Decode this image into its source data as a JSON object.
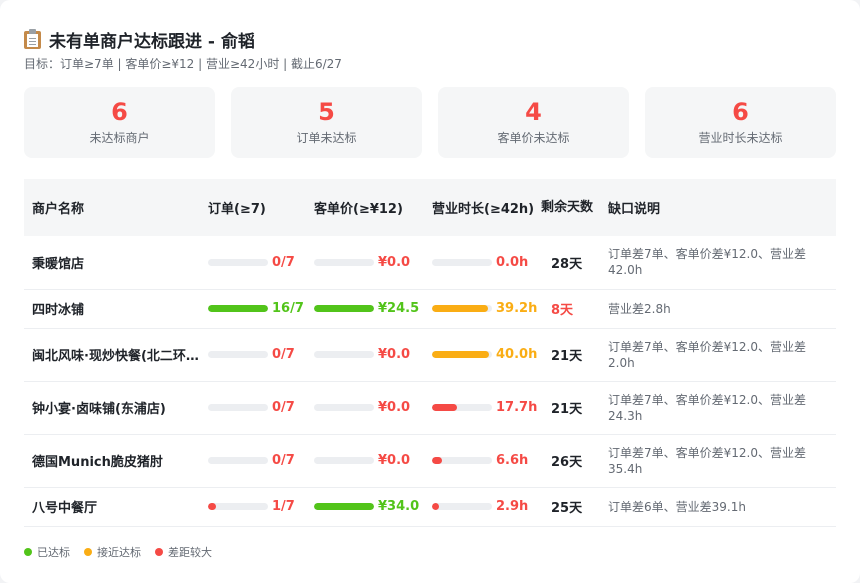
{
  "colors": {
    "green": "#52c41a",
    "yellow": "#faad14",
    "red": "#f54a45",
    "track": "#eceef1"
  },
  "header": {
    "icon": "clipboard-icon",
    "title": "未有单商户达标跟进 - 俞韬",
    "subtitle": "目标：订单≥7单 | 客单价≥¥12 | 营业≥42小时 | 截止6/27"
  },
  "stats": [
    {
      "value": "6",
      "label": "未达标商户"
    },
    {
      "value": "5",
      "label": "订单未达标"
    },
    {
      "value": "4",
      "label": "客单价未达标"
    },
    {
      "value": "6",
      "label": "营业时长未达标"
    }
  ],
  "table": {
    "columns": [
      "商户名称",
      "订单(≥7)",
      "客单价(≥¥12)",
      "营业时长(≥42h)",
      "剩余天数",
      "缺口说明"
    ],
    "rows": [
      {
        "name": "秉暖馆店",
        "orders": {
          "text": "0/7",
          "pct": 0,
          "status": "red"
        },
        "price": {
          "text": "¥0.0",
          "pct": 0,
          "status": "red"
        },
        "hours": {
          "text": "0.0h",
          "pct": 0,
          "status": "red"
        },
        "days": "28天",
        "days_warn": false,
        "note": "订单差7单、客单价差¥12.0、营业差42.0h",
        "tall": true
      },
      {
        "name": "四时冰铺",
        "orders": {
          "text": "16/7",
          "pct": 100,
          "status": "green"
        },
        "price": {
          "text": "¥24.5",
          "pct": 100,
          "status": "green"
        },
        "hours": {
          "text": "39.2h",
          "pct": 93,
          "status": "yellow"
        },
        "days": "8天",
        "days_warn": true,
        "note": "营业差2.8h",
        "tall": false
      },
      {
        "name": "闽北风味·现炒快餐(北二环店)",
        "orders": {
          "text": "0/7",
          "pct": 0,
          "status": "red"
        },
        "price": {
          "text": "¥0.0",
          "pct": 0,
          "status": "red"
        },
        "hours": {
          "text": "40.0h",
          "pct": 95,
          "status": "yellow"
        },
        "days": "21天",
        "days_warn": false,
        "note": "订单差7单、客单价差¥12.0、营业差2.0h",
        "tall": true
      },
      {
        "name": "钟小宴·卤味铺(东浦店)",
        "orders": {
          "text": "0/7",
          "pct": 0,
          "status": "red"
        },
        "price": {
          "text": "¥0.0",
          "pct": 0,
          "status": "red"
        },
        "hours": {
          "text": "17.7h",
          "pct": 42,
          "status": "red"
        },
        "days": "21天",
        "days_warn": false,
        "note": "订单差7单、客单价差¥12.0、营业差24.3h",
        "tall": true
      },
      {
        "name": "德国Munich脆皮猪肘",
        "orders": {
          "text": "0/7",
          "pct": 0,
          "status": "red"
        },
        "price": {
          "text": "¥0.0",
          "pct": 0,
          "status": "red"
        },
        "hours": {
          "text": "6.6h",
          "pct": 16,
          "status": "red"
        },
        "days": "26天",
        "days_warn": false,
        "note": "订单差7单、客单价差¥12.0、营业差35.4h",
        "tall": true
      },
      {
        "name": "八号中餐厅",
        "orders": {
          "text": "1/7",
          "pct": 14,
          "status": "red"
        },
        "price": {
          "text": "¥34.0",
          "pct": 100,
          "status": "green"
        },
        "hours": {
          "text": "2.9h",
          "pct": 7,
          "status": "red"
        },
        "days": "25天",
        "days_warn": false,
        "note": "订单差6单、营业差39.1h",
        "tall": false
      }
    ]
  },
  "legend": [
    {
      "label": "已达标",
      "status": "green"
    },
    {
      "label": "接近达标",
      "status": "yellow"
    },
    {
      "label": "差距较大",
      "status": "red"
    }
  ]
}
